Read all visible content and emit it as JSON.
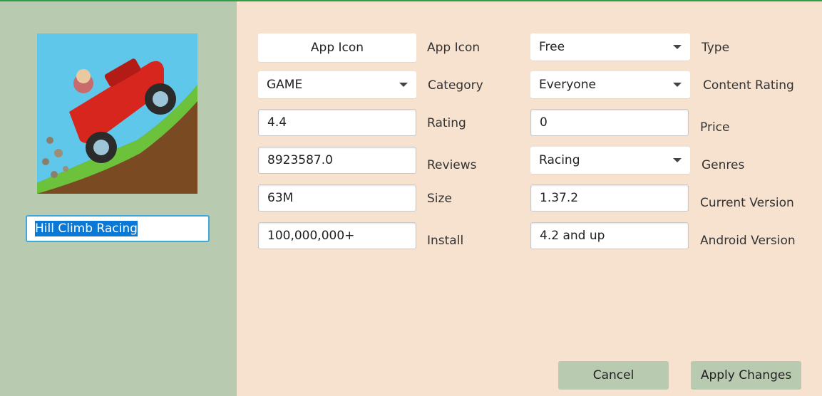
{
  "app_name": "Hill Climb Racing",
  "image": {
    "icon_name": "hill-climb-racing-app-icon"
  },
  "fields": {
    "app_icon_button": "App Icon",
    "app_icon_label": "App Icon",
    "category_value": "GAME",
    "category_label": "Category",
    "rating_value": "4.4",
    "rating_label": "Rating",
    "reviews_value": "8923587.0",
    "reviews_label": "Reviews",
    "size_value": "63M",
    "size_label": "Size",
    "install_value": "100,000,000+",
    "install_label": "Install",
    "type_value": "Free",
    "type_label": "Type",
    "content_rating_value": "Everyone",
    "content_rating_label": "Content Rating",
    "price_value": "0",
    "price_label": "Price",
    "genres_value": "Racing",
    "genres_label": "Genres",
    "current_version_value": "1.37.2",
    "current_version_label": "Current Version",
    "android_version_value": "4.2 and up",
    "android_version_label": "Android Version"
  },
  "buttons": {
    "cancel": "Cancel",
    "apply": "Apply Changes"
  },
  "colors": {
    "left_panel": "#b8cab0",
    "right_panel": "#f7e2cf",
    "top_accent": "#2e9e47",
    "selection": "#0a78d4",
    "focus_border": "#3ea8e0"
  }
}
